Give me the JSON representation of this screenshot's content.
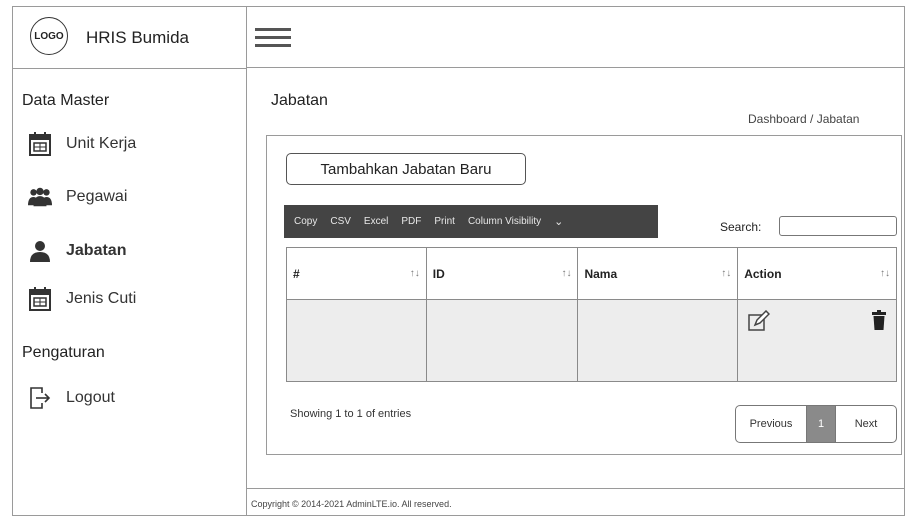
{
  "brand": {
    "logo_text": "LOGO",
    "title": "HRIS Bumida"
  },
  "sidebar": {
    "section_master": "Data Master",
    "items": [
      {
        "label": "Unit Kerja",
        "icon": "calendar-icon"
      },
      {
        "label": "Pegawai",
        "icon": "users-icon"
      },
      {
        "label": "Jabatan",
        "icon": "user-icon"
      },
      {
        "label": "Jenis Cuti",
        "icon": "calendar-icon"
      }
    ],
    "section_settings": "Pengaturan",
    "logout_label": "Logout",
    "active_item": "Jabatan"
  },
  "page": {
    "title": "Jabatan",
    "breadcrumb": "Dashboard / Jabatan"
  },
  "actions": {
    "add_label": "Tambahkan Jabatan Baru"
  },
  "toolbar": {
    "buttons": [
      "Copy",
      "CSV",
      "Excel",
      "PDF",
      "Print",
      "Column Visibility"
    ]
  },
  "search": {
    "label": "Search:",
    "value": ""
  },
  "table": {
    "headers": [
      "#",
      "ID",
      "Nama",
      "Action"
    ],
    "sort_symbol": "↑↓"
  },
  "pagination": {
    "info": "Showing 1 to 1 of entries",
    "prev": "Previous",
    "current": "1",
    "next": "Next"
  },
  "footer": {
    "text": "Copyright © 2014-2021 AdminLTE.io. All reserved."
  }
}
